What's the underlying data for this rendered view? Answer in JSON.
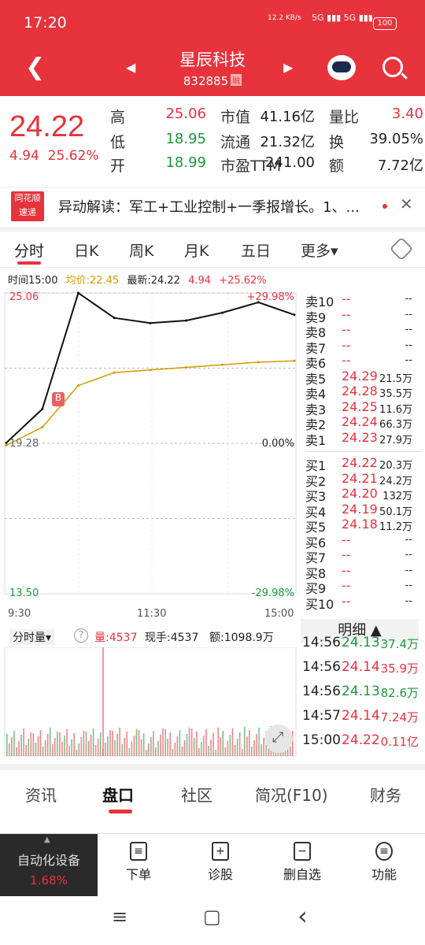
{
  "status": {
    "time": "17:20",
    "net_speed": "12.2 KB/s",
    "signal": "5G ▮▮▮ 5G ▮▮▮",
    "battery": "100"
  },
  "header": {
    "stock_name": "星辰科技",
    "stock_code": "832885",
    "margin_badge": "融"
  },
  "quote": {
    "price": "24.22",
    "change": "4.94",
    "change_pct": "25.62%",
    "rows": [
      {
        "l1": "高",
        "v1": "25.06",
        "c1": "red",
        "l2": "市值",
        "v2": "41.16亿",
        "l3": "量比",
        "v3": "3.40",
        "c3": "red"
      },
      {
        "l1": "低",
        "v1": "18.95",
        "c1": "green",
        "l2": "流通",
        "v2": "21.32亿",
        "l3": "换",
        "v3": "39.05%",
        "c3": "dark"
      },
      {
        "l1": "开",
        "v1": "18.99",
        "c1": "green",
        "l2": "市盈TTM",
        "v2": "241.00",
        "l3": "额",
        "v3": "7.72亿",
        "c3": "dark"
      }
    ]
  },
  "news": {
    "logo_top": "同花顺",
    "logo_bottom": "速递",
    "text": "异动解读：军工+工业控制+一季报增长。1、..."
  },
  "tabs": [
    "分时",
    "日K",
    "周K",
    "月K",
    "五日",
    "更多▾"
  ],
  "info": {
    "time": "时间15:00",
    "avg": "均价:22.45",
    "latest": "最新:24.22",
    "chg": "4.94",
    "pct": "+25.62%"
  },
  "chart": {
    "y_top": "25.06",
    "y_mid": "19.28",
    "y_bot": "13.50",
    "pct_top": "+29.98%",
    "pct_mid": "0.00%",
    "pct_bot": "-29.98%",
    "times": [
      "9:30",
      "11:30",
      "15:00"
    ],
    "marker": "B"
  },
  "chart_data": {
    "type": "line",
    "x": [
      "9:30",
      "10:00",
      "10:30",
      "11:00",
      "11:30",
      "13:30",
      "14:00",
      "14:30",
      "15:00"
    ],
    "series": [
      {
        "name": "最新",
        "values": [
          19.3,
          20.6,
          25.06,
          24.1,
          23.9,
          24.0,
          24.3,
          24.7,
          24.22
        ]
      },
      {
        "name": "均价",
        "values": [
          19.2,
          19.9,
          21.5,
          22.0,
          22.1,
          22.2,
          22.3,
          22.4,
          22.45
        ]
      }
    ],
    "ylim": [
      13.5,
      25.06
    ]
  },
  "book": {
    "asks": [
      {
        "label": "卖10",
        "price": "--",
        "vol": "--"
      },
      {
        "label": "卖9",
        "price": "--",
        "vol": "--"
      },
      {
        "label": "卖8",
        "price": "--",
        "vol": "--"
      },
      {
        "label": "卖7",
        "price": "--",
        "vol": "--"
      },
      {
        "label": "卖6",
        "price": "--",
        "vol": "--"
      },
      {
        "label": "卖5",
        "price": "24.29",
        "vol": "21.5万"
      },
      {
        "label": "卖4",
        "price": "24.28",
        "vol": "35.5万"
      },
      {
        "label": "卖3",
        "price": "24.25",
        "vol": "11.6万"
      },
      {
        "label": "卖2",
        "price": "24.24",
        "vol": "66.3万"
      },
      {
        "label": "卖1",
        "price": "24.23",
        "vol": "27.9万"
      }
    ],
    "bids": [
      {
        "label": "买1",
        "price": "24.22",
        "vol": "20.3万"
      },
      {
        "label": "买2",
        "price": "24.21",
        "vol": "24.2万"
      },
      {
        "label": "买3",
        "price": "24.20",
        "vol": "132万"
      },
      {
        "label": "买4",
        "price": "24.19",
        "vol": "50.1万"
      },
      {
        "label": "买5",
        "price": "24.18",
        "vol": "11.2万"
      },
      {
        "label": "买6",
        "price": "--",
        "vol": "--"
      },
      {
        "label": "买7",
        "price": "--",
        "vol": "--"
      },
      {
        "label": "买8",
        "price": "--",
        "vol": "--"
      },
      {
        "label": "买9",
        "price": "--",
        "vol": "--"
      },
      {
        "label": "买10",
        "price": "--",
        "vol": "--"
      }
    ]
  },
  "volume": {
    "selector": "分时量▾",
    "help": "?",
    "vol": "量:4537",
    "hand": "现手:4537",
    "amount": "额:1098.9万"
  },
  "ticks": {
    "header": "明细 ▲",
    "rows": [
      {
        "t": "14:56",
        "p": "24.13",
        "v": "37.4万",
        "c": "green"
      },
      {
        "t": "14:56",
        "p": "24.14",
        "v": "35.9万",
        "c": "red"
      },
      {
        "t": "14:56",
        "p": "24.13",
        "v": "82.6万",
        "c": "green"
      },
      {
        "t": "14:57",
        "p": "24.14",
        "v": "7.24万",
        "c": "red"
      },
      {
        "t": "15:00",
        "p": "24.22",
        "v": "0.11亿",
        "c": "red"
      }
    ]
  },
  "bottom_tabs": [
    "资讯",
    "盘口",
    "社区",
    "简况(F10)",
    "财务"
  ],
  "toolbar": {
    "sector": "自动化设备",
    "sector_pct": "1.68%",
    "items": [
      {
        "label": "下单",
        "icon": "≡"
      },
      {
        "label": "诊股",
        "icon": "+"
      },
      {
        "label": "删自选",
        "icon": "−"
      },
      {
        "label": "功能",
        "icon": "≡"
      }
    ]
  },
  "navbar": {
    "menu": "≡",
    "home": "▢",
    "back": "‹"
  },
  "colors": {
    "red": "#e8323c",
    "green": "#1a9a3a",
    "avg_line": "#d49b00"
  }
}
